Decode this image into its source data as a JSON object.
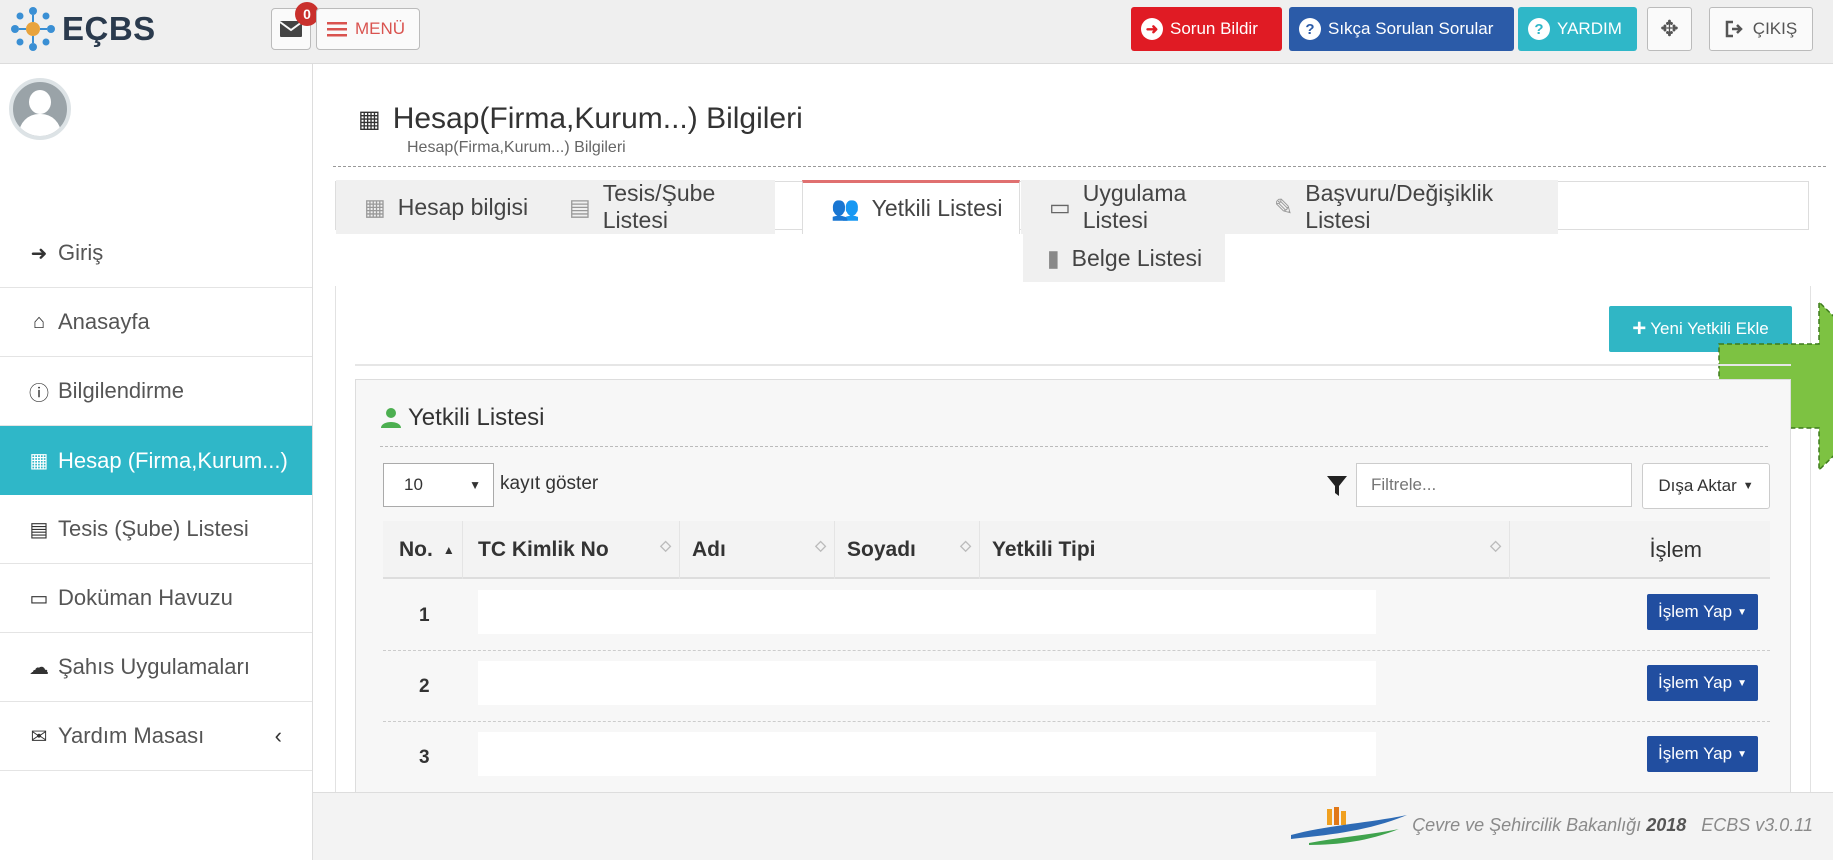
{
  "app": {
    "logo_text": "EÇBS"
  },
  "topbar": {
    "mail_count": "0",
    "menu_label": "MENÜ",
    "report_label": "Sorun Bildir",
    "faq_label": "Sıkça Sorulan Sorular",
    "help_label": "YARDIM",
    "logout_label": "ÇIKIŞ",
    "colors": {
      "report": "#e01b24",
      "faq": "#2b5ba8",
      "help": "#2fb7c8"
    }
  },
  "sidebar": {
    "items": [
      {
        "label": "Giriş",
        "icon": "sign-in-icon"
      },
      {
        "label": "Anasayfa",
        "icon": "home-icon"
      },
      {
        "label": "Bilgilendirme",
        "icon": "info-icon"
      },
      {
        "label": "Hesap (Firma,Kurum...)",
        "icon": "building-icon",
        "active": true
      },
      {
        "label": "Tesis (Şube) Listesi",
        "icon": "clipboard-icon"
      },
      {
        "label": "Doküman Havuzu",
        "icon": "box-icon"
      },
      {
        "label": "Şahıs Uygulamaları",
        "icon": "cloud-icon"
      },
      {
        "label": "Yardım Masası",
        "icon": "envelope-icon"
      }
    ]
  },
  "page": {
    "title": "Hesap(Firma,Kurum...) Bilgileri",
    "subtitle": "Hesap(Firma,Kurum...) Bilgileri"
  },
  "tabs": [
    {
      "label": "Hesap bilgisi",
      "icon": "building-icon"
    },
    {
      "label": "Tesis/Şube Listesi",
      "icon": "clipboard-icon"
    },
    {
      "label": "Yetkili Listesi",
      "icon": "users-icon",
      "active": true
    },
    {
      "label": "Uygulama Listesi",
      "icon": "laptop-icon"
    },
    {
      "label": "Başvuru/Değişiklik Listesi",
      "icon": "edit-icon"
    },
    {
      "label": "Belge Listesi",
      "icon": "file-icon"
    }
  ],
  "add_button": {
    "label": "Yeni Yetkili Ekle"
  },
  "list": {
    "title": "Yetkili Listesi",
    "page_length": "10",
    "length_label": "kayıt göster",
    "filter_placeholder": "Filtrele...",
    "export_label": "Dışa Aktar",
    "columns": [
      "No.",
      "TC Kimlik No",
      "Adı",
      "Soyadı",
      "Yetkili Tipi",
      "İşlem"
    ],
    "rows": [
      {
        "no": "1",
        "action": "İşlem Yap"
      },
      {
        "no": "2",
        "action": "İşlem Yap"
      },
      {
        "no": "3",
        "action": "İşlem Yap"
      }
    ]
  },
  "footer": {
    "ministry": "Çevre ve Şehircilik Bakanlığı",
    "year": "2018",
    "version": "ECBS v3.0.11"
  }
}
